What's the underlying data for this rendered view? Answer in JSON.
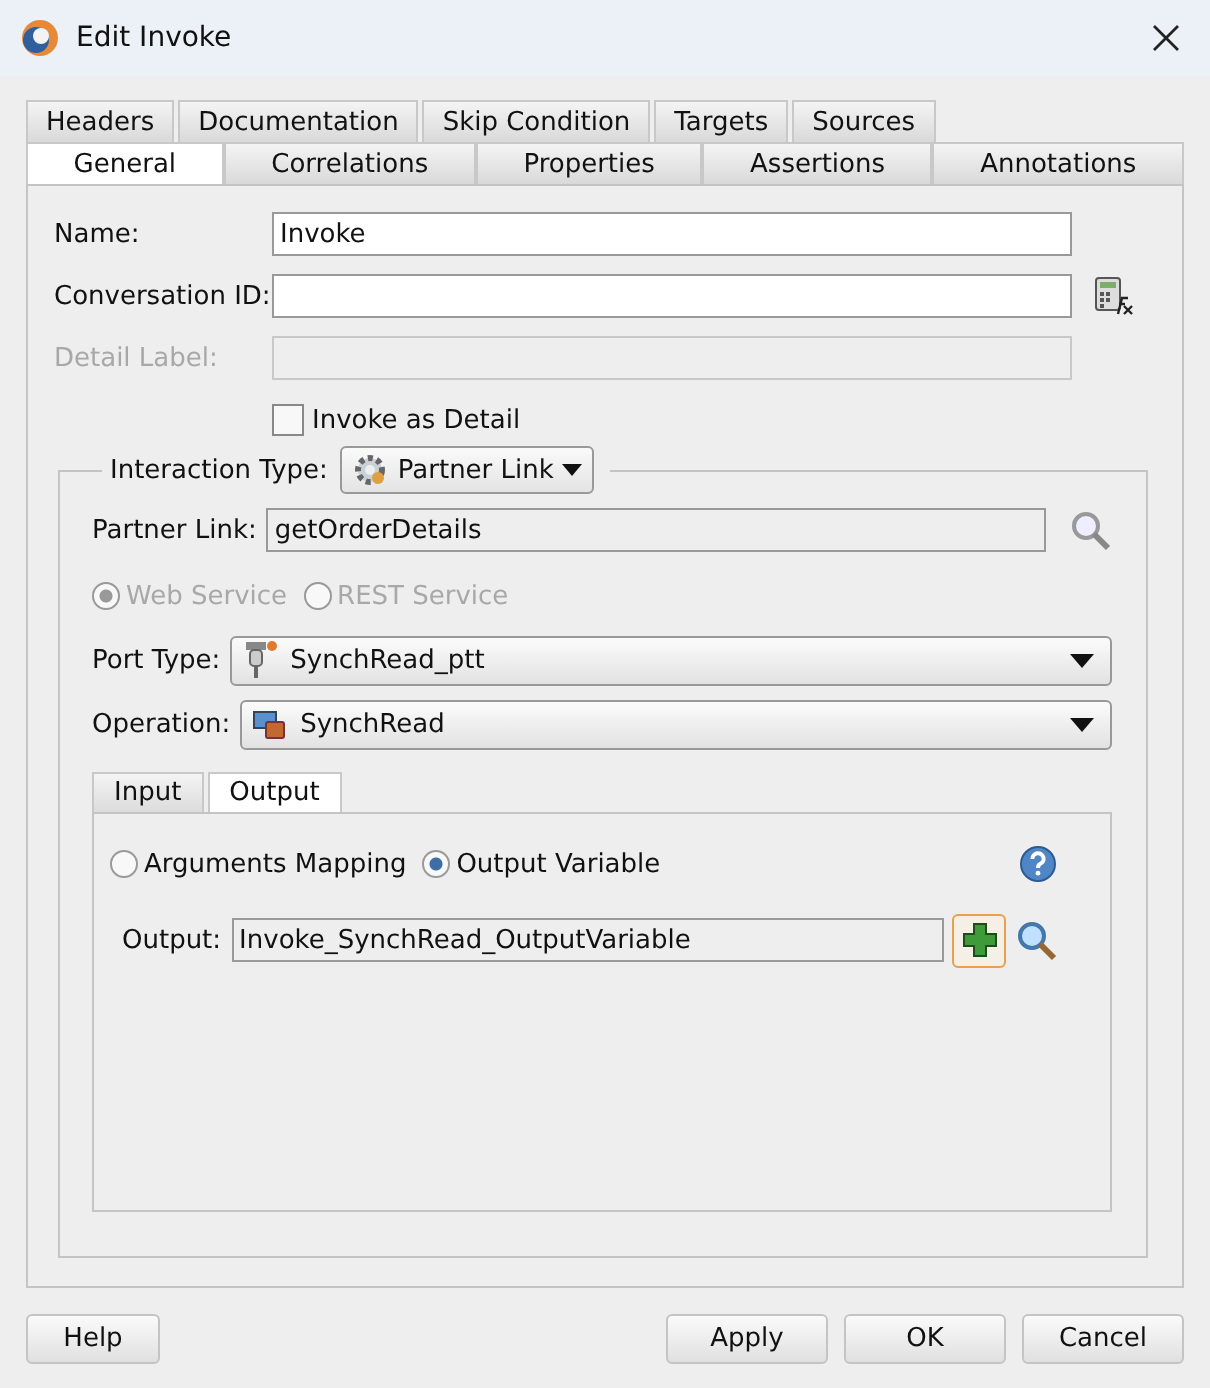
{
  "window": {
    "title": "Edit Invoke"
  },
  "tabs_row_1": [
    {
      "label": "Headers",
      "selected": false
    },
    {
      "label": "Documentation",
      "selected": false
    },
    {
      "label": "Skip Condition",
      "selected": false
    },
    {
      "label": "Targets",
      "selected": false
    },
    {
      "label": "Sources",
      "selected": false
    }
  ],
  "tabs_row_2": [
    {
      "label": "General",
      "selected": true
    },
    {
      "label": "Correlations",
      "selected": false
    },
    {
      "label": "Properties",
      "selected": false
    },
    {
      "label": "Assertions",
      "selected": false
    },
    {
      "label": "Annotations",
      "selected": false
    }
  ],
  "name": {
    "label": "Name:",
    "value": "Invoke"
  },
  "conversation_id": {
    "label": "Conversation ID:"
  },
  "detail_label": {
    "label": "Detail Label:",
    "disabled": true
  },
  "invoke_as_detail": {
    "label": "Invoke as Detail",
    "checked": false
  },
  "interaction_type": {
    "label": "Interaction Type:",
    "value": "Partner Link"
  },
  "partner_link": {
    "label": "Partner Link:",
    "value": "getOrderDetails"
  },
  "service_types": [
    {
      "label": "Web Service",
      "selected": true,
      "disabled": true
    },
    {
      "label": "REST Service",
      "selected": false,
      "disabled": true
    }
  ],
  "port_type": {
    "label": "Port Type:",
    "value": "SynchRead_ptt"
  },
  "operation": {
    "label": "Operation:",
    "value": "SynchRead"
  },
  "inner_tabs": [
    {
      "label": "Input",
      "selected": false
    },
    {
      "label": "Output",
      "selected": true
    }
  ],
  "mapping_options": [
    {
      "label": "Arguments Mapping",
      "selected": false
    },
    {
      "label": "Output Variable",
      "selected": true
    }
  ],
  "output": {
    "label": "Output:",
    "value": "Invoke_SynchRead_OutputVariable"
  },
  "buttons_left": [
    "Help"
  ],
  "buttons_right": [
    "Apply",
    "OK",
    "Cancel"
  ]
}
